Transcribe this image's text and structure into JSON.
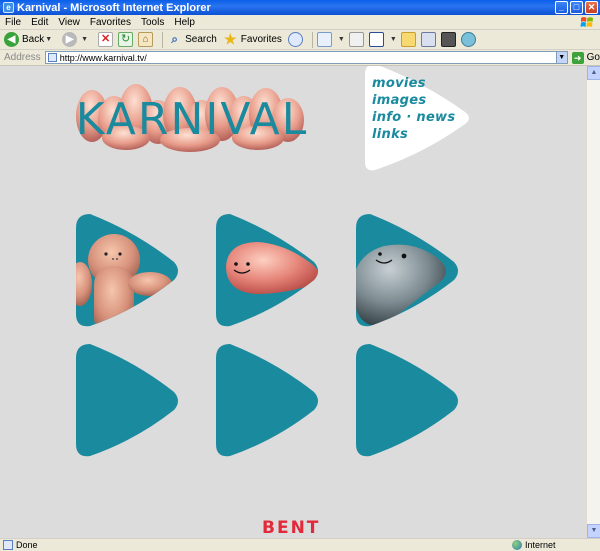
{
  "window": {
    "title": "Karnival - Microsoft Internet Explorer",
    "minimize": "_",
    "maximize": "□",
    "close": "✕"
  },
  "menu": [
    "File",
    "Edit",
    "View",
    "Favorites",
    "Tools",
    "Help"
  ],
  "toolbar": {
    "back_label": "Back",
    "search_label": "Search",
    "favorites_label": "Favorites"
  },
  "address": {
    "label": "Address",
    "url": "http://www.karnival.tv/",
    "go_label": "Go"
  },
  "site": {
    "logo_text": "KARNIVAL",
    "nav": [
      "movies",
      "images",
      "info · news",
      "links"
    ],
    "footer_brand": "BENT",
    "teal": "#1a8a9e",
    "tiles": [
      {
        "name": "tile-pink-creature",
        "has_character": true
      },
      {
        "name": "tile-pink-blob",
        "has_character": true
      },
      {
        "name": "tile-grey-blob",
        "has_character": true
      },
      {
        "name": "tile-empty-1",
        "has_character": false
      },
      {
        "name": "tile-empty-2",
        "has_character": false
      },
      {
        "name": "tile-empty-3",
        "has_character": false
      }
    ]
  },
  "status": {
    "left": "Done",
    "zone": "Internet"
  }
}
